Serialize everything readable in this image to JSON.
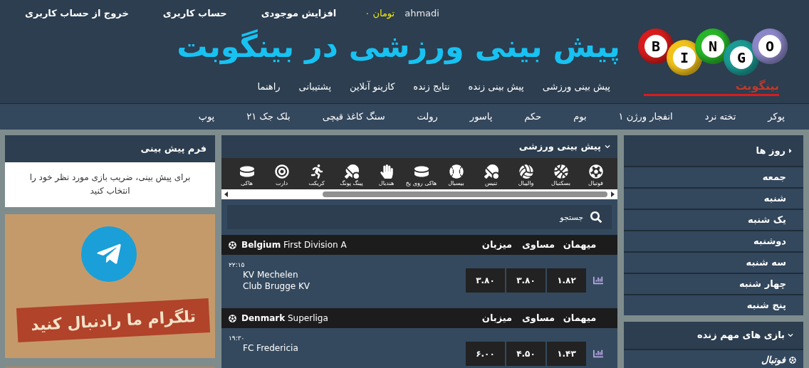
{
  "top_links": [
    {
      "text": "ahmadi",
      "kind": "user"
    },
    {
      "text": "تومان ۰",
      "kind": "balance"
    },
    {
      "text": "افزایش موجودی",
      "kind": "link"
    },
    {
      "text": "حساب کاربری",
      "kind": "link"
    },
    {
      "text": "خروج از حساب کاربری",
      "kind": "link"
    }
  ],
  "logo": {
    "balls": [
      {
        "letter": "B",
        "color": "#d81c1c"
      },
      {
        "letter": "I",
        "color": "#f2c21b"
      },
      {
        "letter": "N",
        "color": "#29b52a"
      },
      {
        "letter": "G",
        "color": "#1c9a94"
      },
      {
        "letter": "O",
        "color": "#8c87c8"
      }
    ],
    "wordmark": "بینگوبت"
  },
  "site_title": "پیش بینی ورزشی در بینگوبت",
  "main_menu": [
    "پیش بینی ورزشی",
    "پیش بینی زنده",
    "نتایج زنده",
    "کازینو آنلاین",
    "پشتیبانی",
    "راهنما"
  ],
  "games_menu": [
    "پوکر",
    "تخته نرد",
    "انفجار ورژن ۱",
    "بوم",
    "حکم",
    "پاسور",
    "رولت",
    "سنگ کاغذ قیچی",
    "بلک جک ۲۱",
    "پوپ"
  ],
  "days": {
    "title": "روز ها",
    "items": [
      "جمعه",
      "شنبه",
      "یک شنبه",
      "دوشنبه",
      "سه شنبه",
      "چهار شنبه",
      "پنج شنبه"
    ]
  },
  "live_games": {
    "title": "بازی های مهم زنده",
    "items": [
      "فوتبال"
    ]
  },
  "sports_betting": {
    "title": "پیش بینی ورزشی",
    "sports": [
      "فوتبال",
      "بسکتبال",
      "والیبال",
      "تنیس",
      "بیسبال",
      "هاکی روی یخ",
      "هندبال",
      "پینگ پونگ",
      "کریکت",
      "دارت",
      "هاکی"
    ],
    "search": {
      "placeholder": "جستجو"
    },
    "leagues": [
      {
        "country": "Belgium",
        "name": "First Division A",
        "columns": [
          "میهمان",
          "مساوی",
          "میزبان"
        ],
        "matches": [
          {
            "time": "۲۲:۱۵",
            "teams": [
              "KV Mechelen",
              "Club Brugge KV"
            ],
            "odds": [
              "۱.۸۲",
              "۳.۸۰",
              "۳.۸۰"
            ]
          }
        ]
      },
      {
        "country": "Denmark",
        "name": "Superliga",
        "columns": [
          "میهمان",
          "مساوی",
          "میزبان"
        ],
        "matches": [
          {
            "time": "۱۹:۳۰",
            "teams": [
              "FC Fredericia"
            ],
            "odds": [
              "۱.۴۳",
              "۴.۵۰",
              "۶.۰۰"
            ]
          }
        ]
      }
    ]
  },
  "prediction_form": {
    "title": "فرم پیش بینی",
    "message": "برای پیش بینی، ضریب بازی مورد نظر خود را انتخاب کنید"
  },
  "banner": {
    "caption": "تلگرام ما رادنبال کنید"
  }
}
